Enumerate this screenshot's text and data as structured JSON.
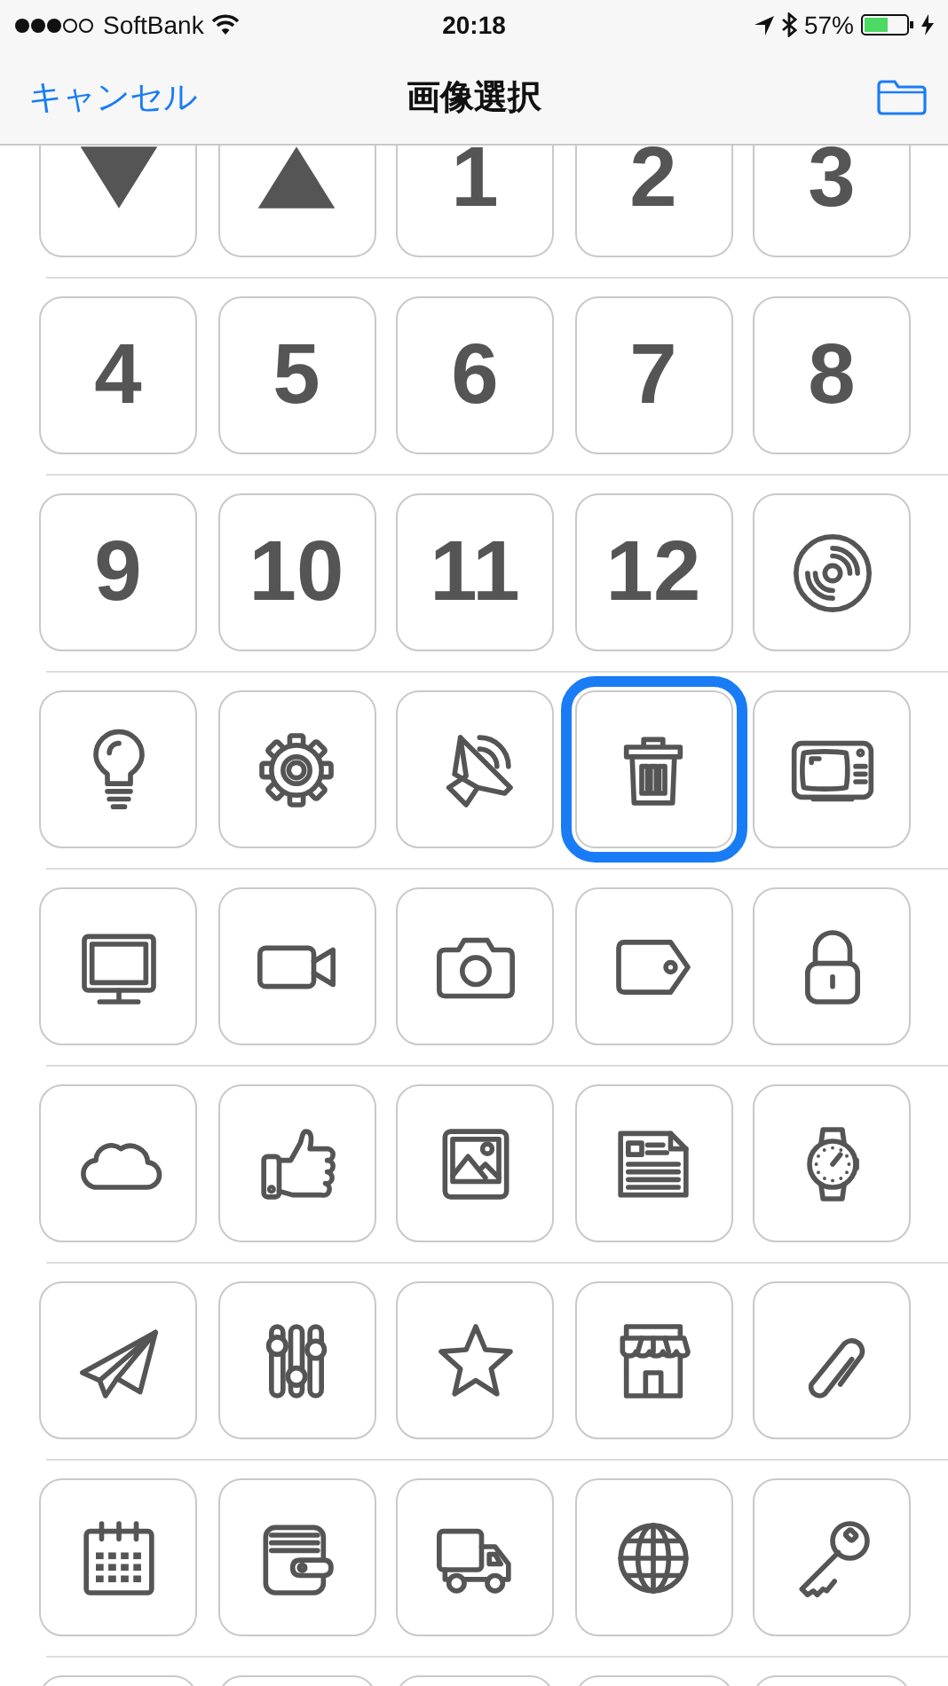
{
  "status_bar": {
    "carrier": "SoftBank",
    "time": "20:18",
    "battery_percent": "57%"
  },
  "nav_bar": {
    "cancel": "キャンセル",
    "title": "画像選択"
  },
  "rows": [
    {
      "tiles": [
        {
          "kind": "icon",
          "selected": false
        },
        {
          "kind": "icon",
          "selected": false
        },
        {
          "kind": "number",
          "label": "1",
          "selected": false
        },
        {
          "kind": "number",
          "label": "2",
          "selected": false
        },
        {
          "kind": "number",
          "label": "3",
          "selected": false
        }
      ]
    },
    {
      "tiles": [
        {
          "kind": "number",
          "label": "4",
          "selected": false
        },
        {
          "kind": "number",
          "label": "5",
          "selected": false
        },
        {
          "kind": "number",
          "label": "6",
          "selected": false
        },
        {
          "kind": "number",
          "label": "7",
          "selected": false
        },
        {
          "kind": "number",
          "label": "8",
          "selected": false
        }
      ]
    },
    {
      "tiles": [
        {
          "kind": "number",
          "label": "9",
          "selected": false
        },
        {
          "kind": "number",
          "label": "10",
          "selected": false
        },
        {
          "kind": "number",
          "label": "11",
          "selected": false
        },
        {
          "kind": "number",
          "label": "12",
          "selected": false
        },
        {
          "kind": "icon",
          "selected": false
        }
      ]
    },
    {
      "tiles": [
        {
          "kind": "icon",
          "selected": false
        },
        {
          "kind": "icon",
          "selected": false
        },
        {
          "kind": "icon",
          "selected": false
        },
        {
          "kind": "icon",
          "selected": true
        },
        {
          "kind": "icon",
          "selected": false
        }
      ]
    },
    {
      "tiles": [
        {
          "kind": "icon",
          "selected": false
        },
        {
          "kind": "icon",
          "selected": false
        },
        {
          "kind": "icon",
          "selected": false
        },
        {
          "kind": "icon",
          "selected": false
        },
        {
          "kind": "icon",
          "selected": false
        }
      ]
    },
    {
      "tiles": [
        {
          "kind": "icon",
          "selected": false
        },
        {
          "kind": "icon",
          "selected": false
        },
        {
          "kind": "icon",
          "selected": false
        },
        {
          "kind": "icon",
          "selected": false
        },
        {
          "kind": "icon",
          "selected": false
        }
      ]
    },
    {
      "tiles": [
        {
          "kind": "icon",
          "selected": false
        },
        {
          "kind": "icon",
          "selected": false
        },
        {
          "kind": "icon",
          "selected": false
        },
        {
          "kind": "icon",
          "selected": false
        },
        {
          "kind": "icon",
          "selected": false
        }
      ]
    },
    {
      "tiles": [
        {
          "kind": "icon",
          "selected": false
        },
        {
          "kind": "icon",
          "selected": false
        },
        {
          "kind": "icon",
          "selected": false
        },
        {
          "kind": "icon",
          "selected": false
        },
        {
          "kind": "icon",
          "selected": false
        }
      ]
    },
    {
      "tiles": [
        {
          "kind": "cut",
          "selected": false
        },
        {
          "kind": "cut",
          "selected": false
        },
        {
          "kind": "cut",
          "selected": false
        },
        {
          "kind": "cut",
          "selected": false
        },
        {
          "kind": "cut",
          "selected": false
        }
      ]
    }
  ]
}
